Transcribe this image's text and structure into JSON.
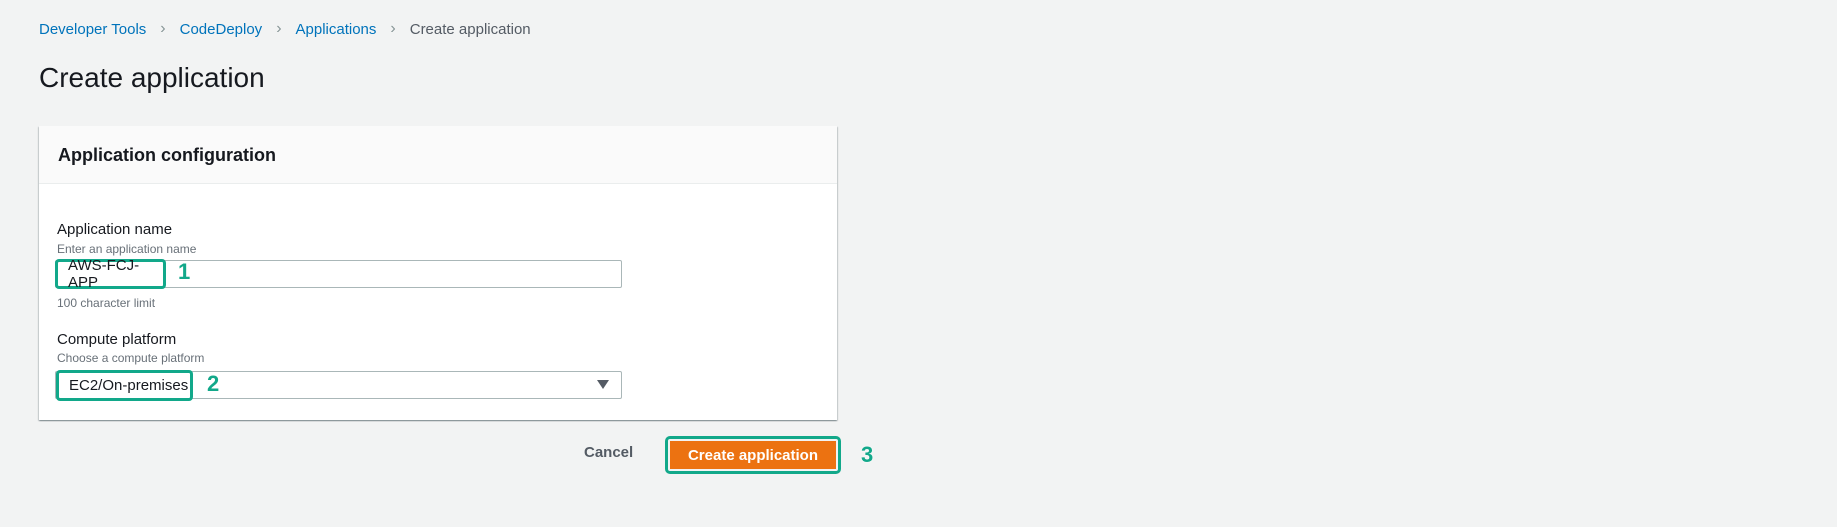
{
  "breadcrumb": [
    "Developer Tools",
    "CodeDeploy",
    "Applications",
    "Create application"
  ],
  "page_title": "Create application",
  "panel": {
    "title": "Application configuration",
    "app_name": {
      "label": "Application name",
      "hint": "Enter an application name",
      "value": "AWS-FCJ-APP",
      "constraint": "100 character limit"
    },
    "compute_platform": {
      "label": "Compute platform",
      "hint": "Choose a compute platform",
      "value": "EC2/On-premises"
    }
  },
  "actions": {
    "cancel": "Cancel",
    "create": "Create application"
  },
  "annotations": [
    "1",
    "2",
    "3"
  ],
  "colors": {
    "accent": "#ec7211",
    "link": "#0073bb",
    "highlight": "#12a88a"
  }
}
